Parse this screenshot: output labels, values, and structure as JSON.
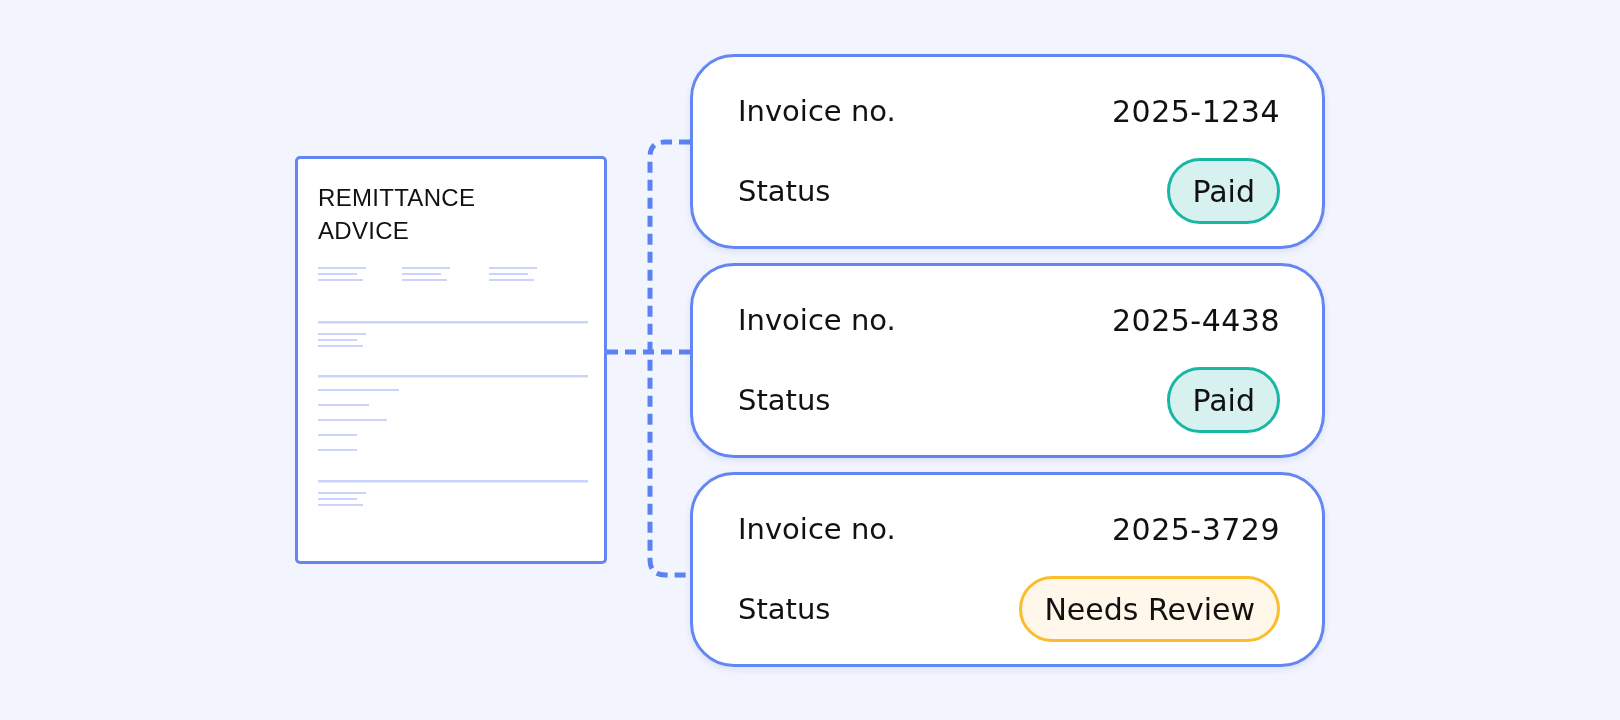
{
  "document": {
    "title": "REMITTANCE ADVICE"
  },
  "invoices": [
    {
      "label": "Invoice no.",
      "number": "2025-1234",
      "status_label": "Status",
      "status": {
        "text": "Paid",
        "kind": "paid"
      }
    },
    {
      "label": "Invoice no.",
      "number": "2025-4438",
      "status_label": "Status",
      "status": {
        "text": "Paid",
        "kind": "paid"
      }
    },
    {
      "label": "Invoice no.",
      "number": "2025-3729",
      "status_label": "Status",
      "status": {
        "text": "Needs Review",
        "kind": "review"
      }
    }
  ]
}
